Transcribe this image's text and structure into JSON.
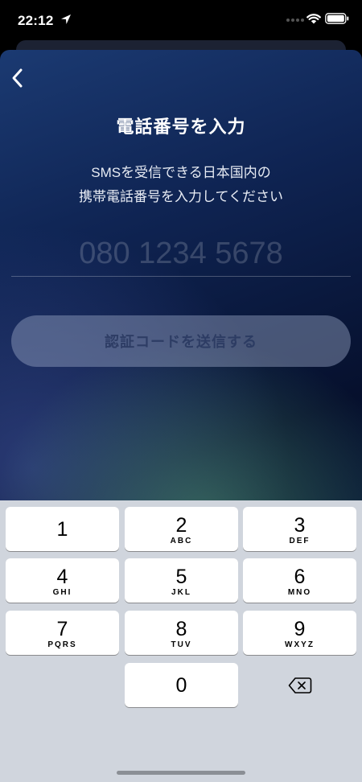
{
  "status_bar": {
    "time": "22:12",
    "icons": [
      "location-arrow-icon",
      "cellular-signal-icon",
      "wifi-icon",
      "battery-icon"
    ]
  },
  "header": {
    "back_icon": "chevron-left-icon",
    "title": "電話番号を入力"
  },
  "description": {
    "line1": "SMSを受信できる日本国内の",
    "line2": "携帯電話番号を入力してください"
  },
  "phone_input": {
    "value": "",
    "placeholder": "080 1234 5678"
  },
  "send_button": {
    "label": "認証コードを送信する"
  },
  "keypad": {
    "keys": [
      {
        "digit": "1",
        "letters": ""
      },
      {
        "digit": "2",
        "letters": "ABC"
      },
      {
        "digit": "3",
        "letters": "DEF"
      },
      {
        "digit": "4",
        "letters": "GHI"
      },
      {
        "digit": "5",
        "letters": "JKL"
      },
      {
        "digit": "6",
        "letters": "MNO"
      },
      {
        "digit": "7",
        "letters": "PQRS"
      },
      {
        "digit": "8",
        "letters": "TUV"
      },
      {
        "digit": "9",
        "letters": "WXYZ"
      },
      {
        "digit": "0",
        "letters": ""
      }
    ],
    "delete_icon": "backspace-icon"
  },
  "colors": {
    "sheet_top": "#1b3a72",
    "sheet_dark": "#06102d",
    "keypad_bg": "#d0d5dd",
    "button_bg": "#96a5c3"
  }
}
